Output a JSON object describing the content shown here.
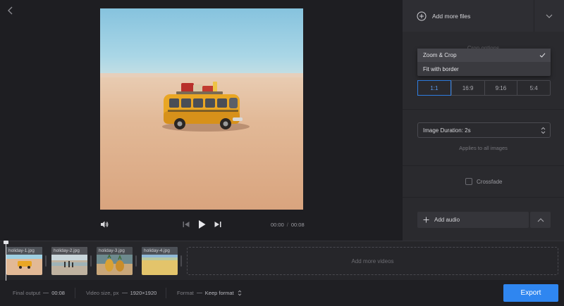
{
  "header": {
    "back_icon": "chevron-left-icon"
  },
  "player": {
    "current_time": "00:00",
    "separator": "/",
    "total_time": "00:08",
    "icons": [
      "volume-icon",
      "skip-back-icon",
      "play-icon",
      "skip-forward-icon"
    ]
  },
  "panel": {
    "add_files_label": "Add more files",
    "crop": {
      "title": "Crop options",
      "selected_option": "Zoom & Crop",
      "options": [
        "Zoom & Crop",
        "Fit with border"
      ],
      "ratios": [
        "1:1",
        "16:9",
        "9:16",
        "5:4"
      ],
      "active_ratio": "1:1"
    },
    "duration": {
      "value": "Image Duration: 2s",
      "hint": "Applies to all images"
    },
    "crossfade": {
      "label": "Crossfade",
      "checked": false
    },
    "audio": {
      "label": "Add audio"
    }
  },
  "timeline": {
    "clips": [
      {
        "label": "holiday-1.jpg"
      },
      {
        "label": "holiday-2.jpg"
      },
      {
        "label": "holiday-3.jpg"
      },
      {
        "label": "holiday-4.jpg"
      }
    ],
    "add_more_label": "Add more videos"
  },
  "bottombar": {
    "final_output_label": "Final output",
    "final_output_value": "00:08",
    "video_size_label": "Video size, px",
    "video_size_value": "1920×1920",
    "format_label": "Format",
    "format_value": "Keep format",
    "export_label": "Export"
  },
  "colors": {
    "accent": "#2f86f0",
    "active_ratio": "#2f7de0",
    "background": "#1c1c1f",
    "panel": "#2a2a2e"
  }
}
